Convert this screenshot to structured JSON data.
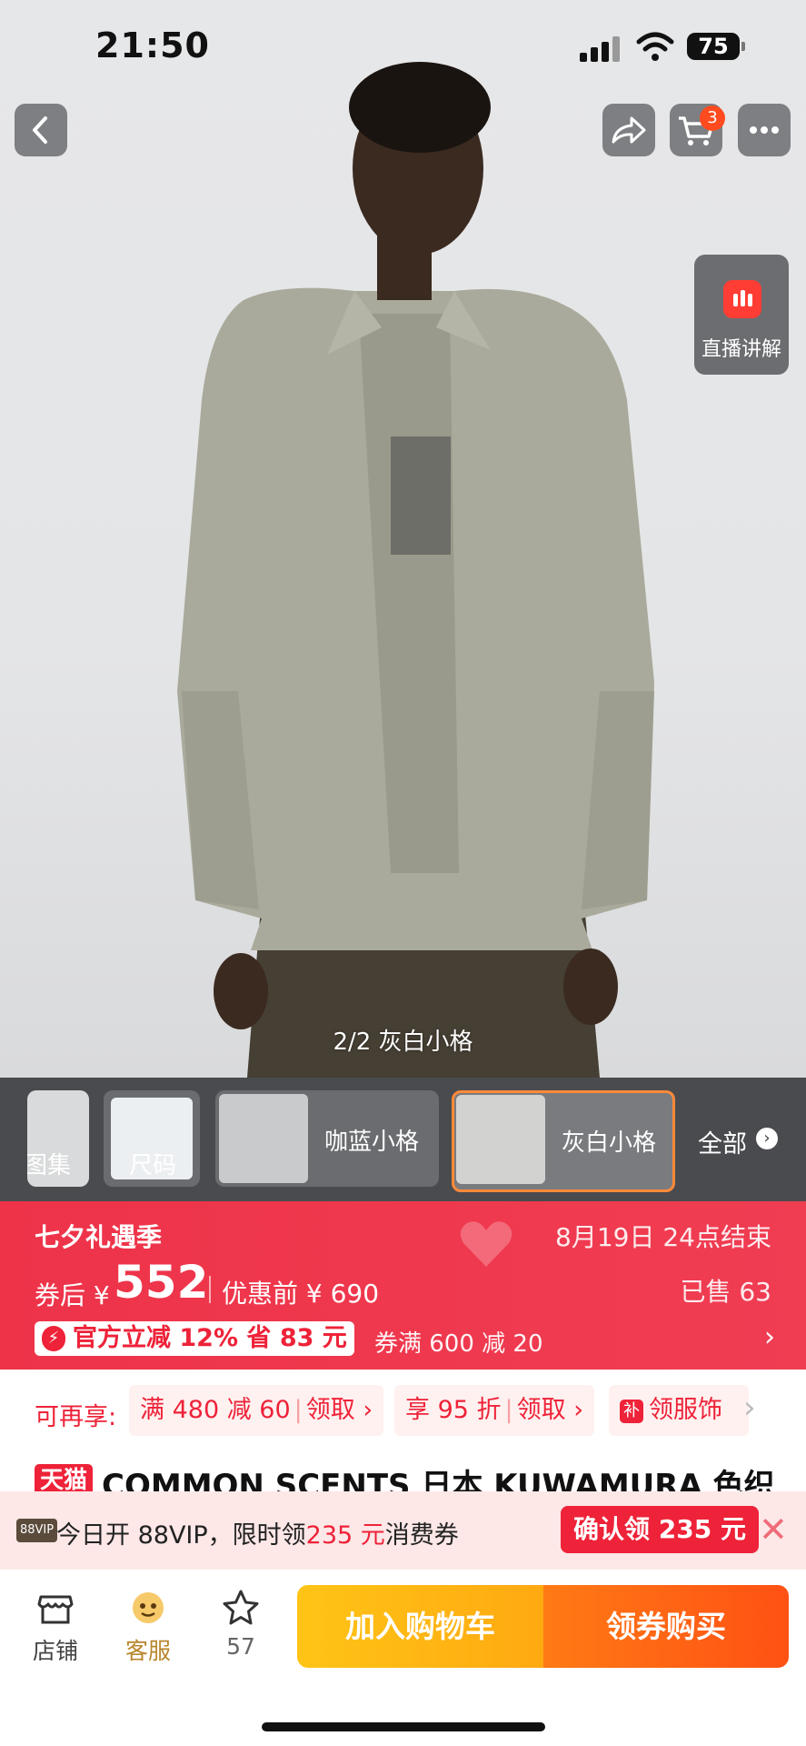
{
  "status": {
    "time": "21:50",
    "battery": "75"
  },
  "nav": {
    "cart_count": "3"
  },
  "live": {
    "label": "直播讲解"
  },
  "gallery": {
    "pager": "2/2 灰白小格"
  },
  "variants": {
    "items": [
      {
        "label": "图集"
      },
      {
        "label": "尺码"
      },
      {
        "label": "咖蓝小格"
      },
      {
        "label": "灰白小格",
        "selected": true
      }
    ],
    "all_label": "全部"
  },
  "promo": {
    "event": "七夕礼遇季",
    "end_time": "8月19日 24点结束",
    "after_coupon_label": "券后 ¥",
    "price": "552",
    "original": "优惠前 ¥ 690",
    "sold": "已售 63",
    "discount_tag": "官方立减 12% 省 83 元",
    "coupon": "券满 600 减 20"
  },
  "offers": {
    "header": "可再享:",
    "chips": [
      {
        "text": "满 480 减 60",
        "action": "领取"
      },
      {
        "text": "享 95 折",
        "action": "领取"
      },
      {
        "badge": "补",
        "text": "领服饰"
      }
    ]
  },
  "product": {
    "mall_tag": "天猫",
    "title": "COMMON SCENTS 日本 KUWAMURA 色织"
  },
  "vip": {
    "badge": "88VIP",
    "text_prefix": "今日开 88VIP，限时领",
    "amount": "235 元",
    "text_suffix": "消费券",
    "button": "确认领 235 元"
  },
  "bottom": {
    "store_label": "店铺",
    "service_label": "客服",
    "favorite_count": "57",
    "add_to_cart": "加入购物车",
    "buy_now": "领券购买"
  },
  "colors": {
    "accent_red": "#ee2238",
    "orange": "#ff5114",
    "yellow": "#ffc416"
  }
}
